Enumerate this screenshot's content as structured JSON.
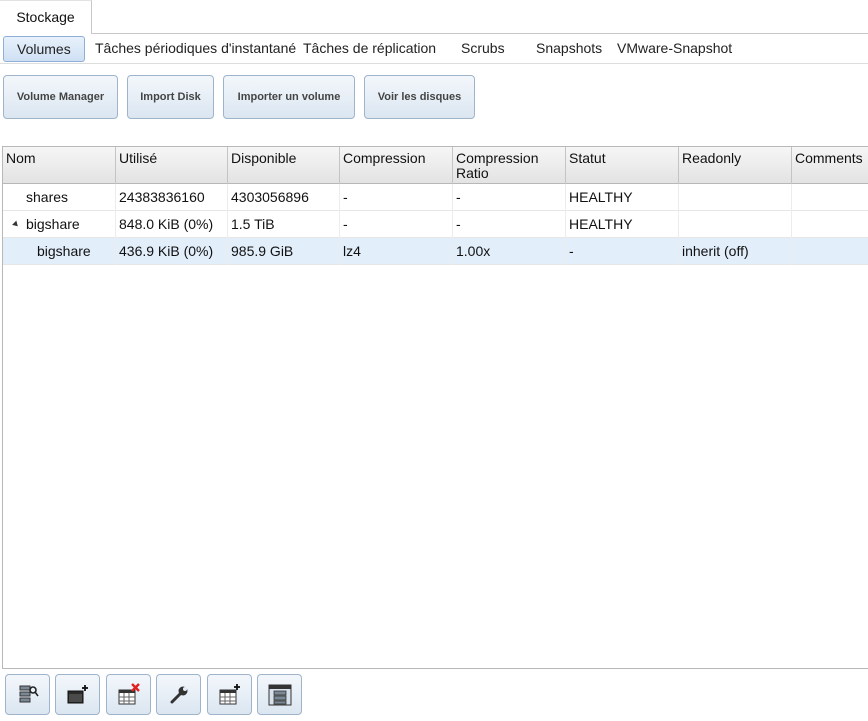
{
  "top_tab": {
    "label": "Stockage"
  },
  "sub_tabs": [
    {
      "label": "Volumes",
      "active": true
    },
    {
      "label": "Tâches périodiques d'instantané"
    },
    {
      "label": "Tâches de réplication"
    },
    {
      "label": "Scrubs"
    },
    {
      "label": "Snapshots"
    },
    {
      "label": "VMware-Snapshot"
    }
  ],
  "actions": [
    {
      "label": "Volume Manager"
    },
    {
      "label": "Import Disk"
    },
    {
      "label": "Importer un volume"
    },
    {
      "label": "Voir les disques"
    }
  ],
  "table": {
    "columns": [
      "Nom",
      "Utilisé",
      "Disponible",
      "Compression",
      "Compression Ratio",
      "Statut",
      "Readonly",
      "Comments"
    ],
    "rows": [
      {
        "name": "shares",
        "used": "24383836160",
        "available": "4303056896",
        "compression": "-",
        "ratio": "-",
        "status": "HEALTHY",
        "readonly": "",
        "comments": ""
      },
      {
        "name": "bigshare",
        "used": "848.0 KiB (0%)",
        "available": "1.5 TiB",
        "compression": "-",
        "ratio": "-",
        "status": "HEALTHY",
        "readonly": "",
        "comments": "",
        "expanded": true
      },
      {
        "name": "bigshare",
        "used": "436.9 KiB (0%)",
        "available": "985.9 GiB",
        "compression": "lz4",
        "ratio": "1.00x",
        "status": "-",
        "readonly": "inherit (off)",
        "comments": "",
        "selected": true
      }
    ]
  },
  "toolbar_icons": [
    "detach-volume-icon",
    "create-dataset-icon",
    "destroy-volume-icon",
    "edit-options-icon",
    "create-zvol-icon",
    "volume-status-icon"
  ],
  "colors": {
    "selection": "#e3eefb",
    "button_border": "#9fb4cb",
    "delete_red": "#e02020"
  }
}
